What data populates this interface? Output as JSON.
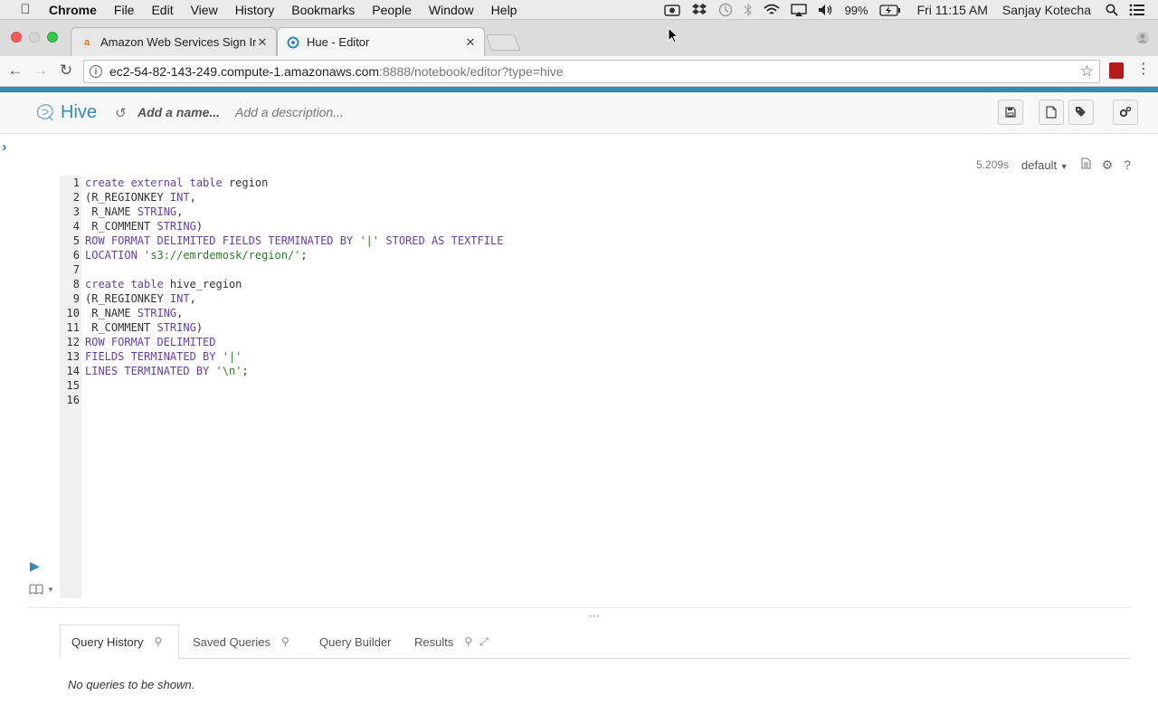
{
  "menubar": {
    "app": "Chrome",
    "items": [
      "File",
      "Edit",
      "View",
      "History",
      "Bookmarks",
      "People",
      "Window",
      "Help"
    ],
    "battery": "99%",
    "clock": "Fri 11:15 AM",
    "user": "Sanjay Kotecha"
  },
  "tabs": [
    {
      "title": "Amazon Web Services Sign In",
      "favicon": "amazon-icon"
    },
    {
      "title": "Hue - Editor",
      "favicon": "hue-icon"
    }
  ],
  "omnibox": {
    "host": "ec2-54-82-143-249.compute-1.amazonaws.com",
    "rest": ":8888/notebook/editor?type=hive"
  },
  "hue": {
    "brand": "Hive",
    "name_placeholder": "Add a name...",
    "description_placeholder": "Add a description..."
  },
  "snippet": {
    "execution_time": "5.209s",
    "database": "default"
  },
  "editor": {
    "line_numbers": [
      "1",
      "2",
      "3",
      "4",
      "5",
      "6",
      "7",
      "8",
      "9",
      "10",
      "11",
      "12",
      "13",
      "14",
      "15",
      "16"
    ]
  },
  "bottom": {
    "tabs": [
      "Query History",
      "Saved Queries",
      "Query Builder",
      "Results"
    ],
    "empty_message": "No queries to be shown."
  }
}
